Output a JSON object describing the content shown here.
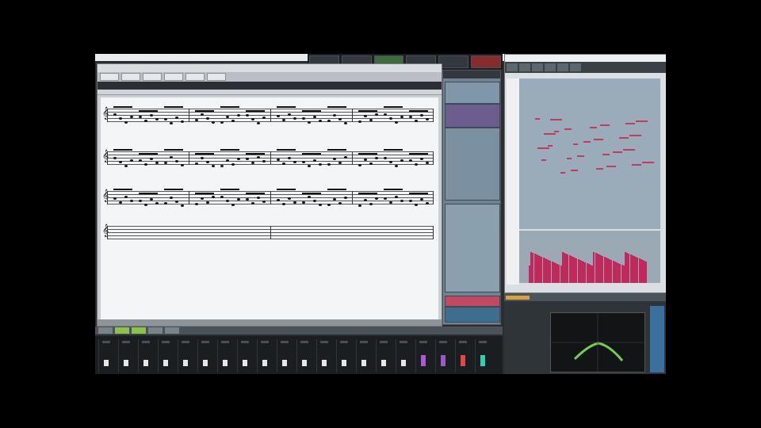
{
  "colors": {
    "velocity": "#c02a5a",
    "midi_note": "#c23a5e",
    "spectrum_curve": "#6fd04d",
    "accent_orange": "#d9a23b",
    "accent_blue": "#3b6f9e"
  },
  "mixer": {
    "channel_count": 20,
    "colored_channels": [
      {
        "index": 16,
        "color": "#b057d6"
      },
      {
        "index": 17,
        "color": "#9b59c9"
      },
      {
        "index": 18,
        "color": "#e84545"
      },
      {
        "index": 19,
        "color": "#2fd1b2"
      }
    ]
  }
}
